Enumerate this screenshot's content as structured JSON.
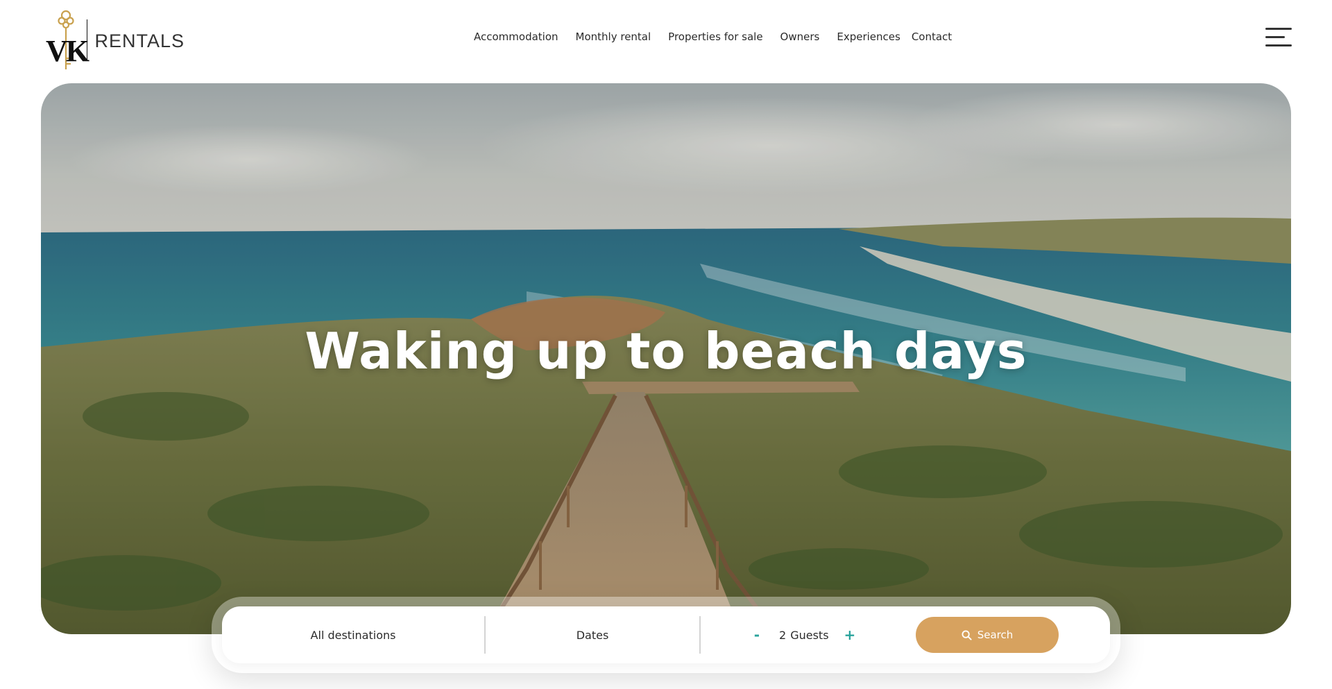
{
  "brand": {
    "monogram": "VK",
    "wordmark": "RENTALS",
    "key_color": "#c9a14e"
  },
  "nav": {
    "items": [
      {
        "label": "Accommodation"
      },
      {
        "label": "Monthly rental"
      },
      {
        "label": "Properties for sale"
      },
      {
        "label": "Owners"
      },
      {
        "label": "Experiences"
      },
      {
        "label": "Contact"
      }
    ],
    "menu_icon": "hamburger-menu-icon"
  },
  "hero": {
    "title": "Waking up to beach days",
    "image_subject": "coastal cliff boardwalk stairs leading to beach"
  },
  "search": {
    "destination": "All destinations",
    "dates": "Dates",
    "guests": {
      "decrement": "-",
      "count": "2",
      "label": "Guests",
      "increment": "+"
    },
    "button_label": "Search",
    "button_icon": "search-icon",
    "accent_color": "#d7a25f",
    "stepper_color": "#2aa39c"
  }
}
